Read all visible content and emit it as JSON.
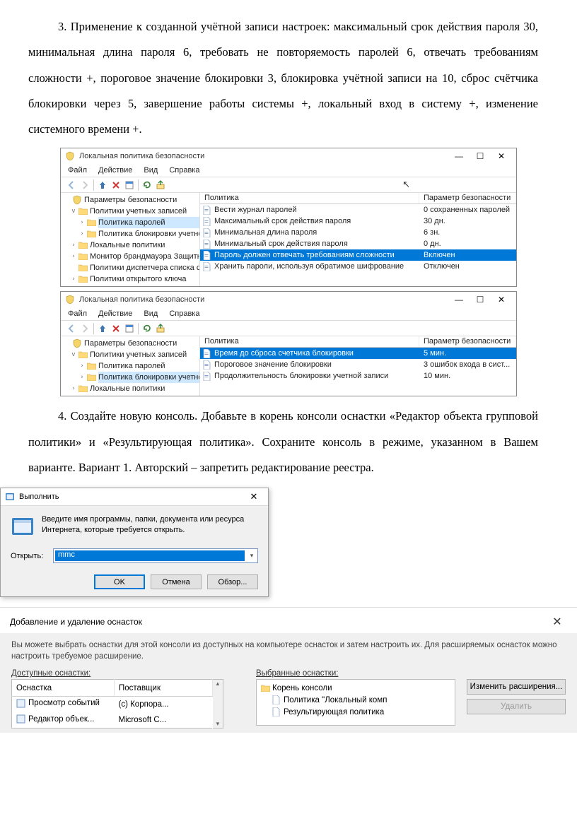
{
  "para3": "3. Применение к созданной учётной записи настроек: максимальный срок действия пароля 30, минимальная длина пароля 6, требовать не повторяемость паролей 6, отвечать требованиям сложности +, пороговое значение блокировки 3, блокировка учётной записи на 10, сброс счётчика блокировки через 5, завершение работы системы +, локальный вход в систему +, изменение системного времени +.",
  "para4": "4. Создайте новую консоль. Добавьте в корень консоли оснастки «Редактор объекта групповой политики» и «Результирующая политика». Сохраните консоль в режиме, указанном в Вашем варианте.  Вариант 1. Авторский – запретить редактирование реестра.",
  "secpol": {
    "title": "Локальная политика безопасности",
    "menu": [
      "Файл",
      "Действие",
      "Вид",
      "Справка"
    ],
    "tree": {
      "root": "Параметры безопасности",
      "n1": "Политики учетных записей",
      "n1a": "Политика паролей",
      "n1b": "Политика блокировки учетной з",
      "n2": "Локальные политики",
      "n3": "Монитор брандмауэра Защитника",
      "n4": "Политики диспетчера списка сетей",
      "n5": "Политики открытого ключа"
    },
    "hdr1": "Политика",
    "hdr2": "Параметр безопасности",
    "passrows": [
      {
        "p": "Вести журнал паролей",
        "v": "0 сохраненных паролей"
      },
      {
        "p": "Максимальный срок действия пароля",
        "v": "30 дн."
      },
      {
        "p": "Минимальная длина пароля",
        "v": "6 зн."
      },
      {
        "p": "Минимальный срок действия пароля",
        "v": "0 дн."
      },
      {
        "p": "Пароль должен отвечать требованиям сложности",
        "v": "Включен",
        "sel": true
      },
      {
        "p": "Хранить пароли, используя обратимое шифрование",
        "v": "Отключен"
      }
    ],
    "lockrows": [
      {
        "p": "Время до сброса счетчика блокировки",
        "v": "5 мин.",
        "sel": true
      },
      {
        "p": "Пороговое значение блокировки",
        "v": "3 ошибок входа в сист..."
      },
      {
        "p": "Продолжительность блокировки учетной записи",
        "v": "10 мин."
      }
    ]
  },
  "rundlg": {
    "title": "Выполнить",
    "msg": "Введите имя программы, папки, документа или ресурса Интернета, которые требуется открыть.",
    "openlabel": "Открыть:",
    "value": "mmc",
    "ok": "OK",
    "cancel": "Отмена",
    "browse": "Обзор..."
  },
  "snapdlg": {
    "title": "Добавление и удаление оснасток",
    "msg": "Вы можете выбрать оснастки для этой консоли из доступных на компьютере оснасток и затем настроить их. Для расширяемых оснасток можно настроить требуемое расширение.",
    "avlabel": "Доступные оснастки:",
    "sellabel": "Выбранные оснастки:",
    "avhdr1": "Оснастка",
    "avhdr2": "Поставщик",
    "avrows": [
      {
        "n": "Просмотр событий",
        "v": "(c) Корпора..."
      },
      {
        "n": "Редактор объек...",
        "v": "Microsoft C..."
      }
    ],
    "selroot": "Корень консоли",
    "sel1": "Политика \"Локальный комп",
    "sel2": "Результирующая политика",
    "btnEdit": "Изменить расширения...",
    "btnDel": "Удалить"
  }
}
